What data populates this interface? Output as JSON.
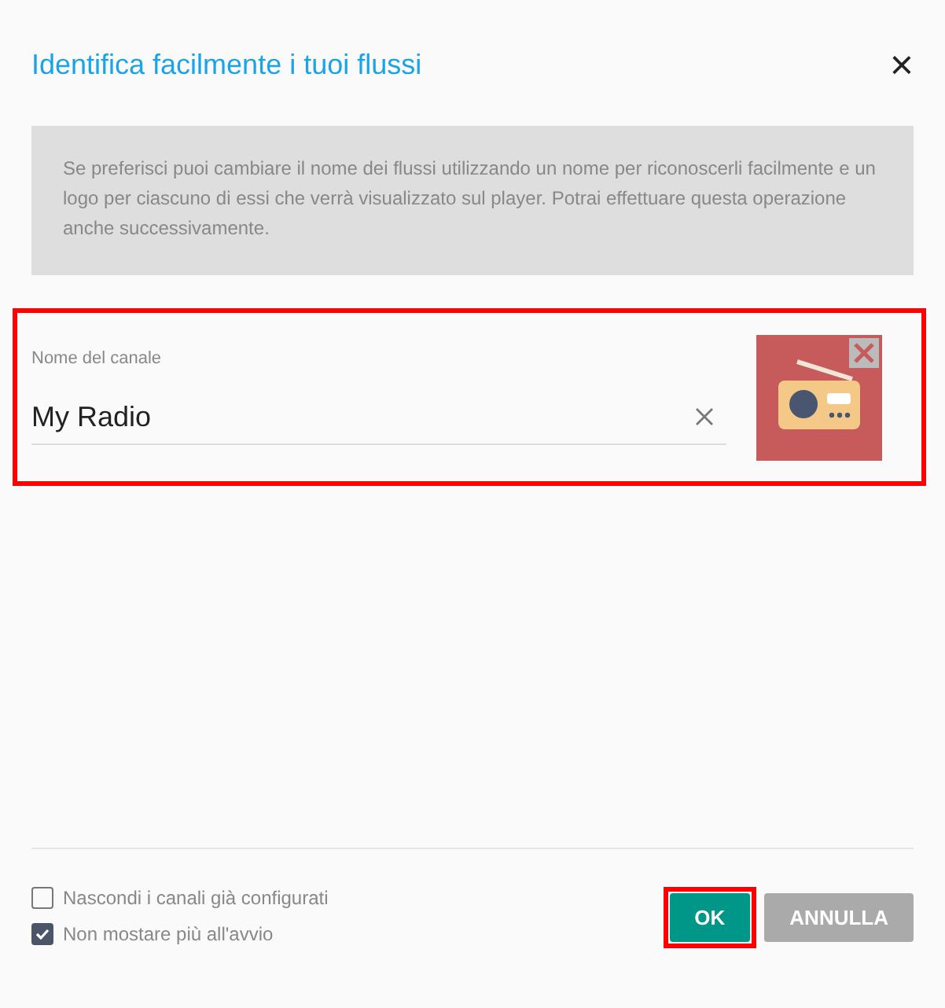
{
  "dialog": {
    "title": "Identifica facilmente i tuoi flussi",
    "close": "×"
  },
  "info": "Se preferisci puoi cambiare il nome dei flussi utilizzando un nome per riconoscerli facilmente e un logo per ciascuno di essi che verrà visualizzato sul player. Potrai effettuare questa operazione anche successivamente.",
  "channel": {
    "label": "Nome del canale",
    "value": "My Radio",
    "highlighted": true
  },
  "options": [
    {
      "label": "Nascondi i canali già configurati",
      "checked": false
    },
    {
      "label": "Non mostare più all'avvio",
      "checked": true
    }
  ],
  "buttons": [
    {
      "label": "OK",
      "kind": "primary",
      "highlighted": true
    },
    {
      "label": "ANNULLA",
      "kind": "secondary",
      "highlighted": false
    }
  ]
}
